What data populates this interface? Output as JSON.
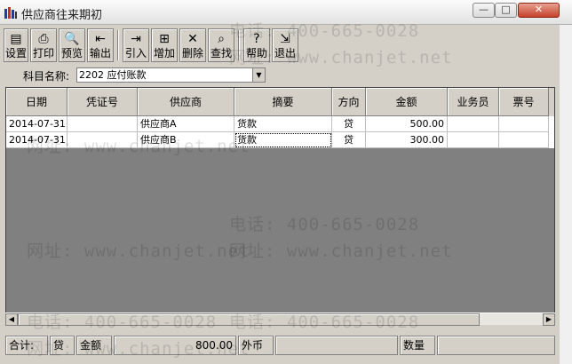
{
  "window": {
    "title": "供应商往来期初",
    "min_glyph": "—",
    "max_glyph": "□",
    "close_glyph": "✕"
  },
  "toolbar": {
    "buttons": [
      {
        "label": "设置",
        "icon": "settings-icon",
        "glyph": "▤"
      },
      {
        "label": "打印",
        "icon": "print-icon",
        "glyph": "⎙"
      },
      {
        "label": "预览",
        "icon": "preview-icon",
        "glyph": "🔍"
      },
      {
        "label": "输出",
        "icon": "export-icon",
        "glyph": "⇤"
      },
      {
        "label": "引入",
        "icon": "import-icon",
        "glyph": "⇥"
      },
      {
        "label": "增加",
        "icon": "add-icon",
        "glyph": "⊞"
      },
      {
        "label": "删除",
        "icon": "delete-icon",
        "glyph": "✕"
      },
      {
        "label": "查找",
        "icon": "find-icon",
        "glyph": "⌕"
      },
      {
        "label": "帮助",
        "icon": "help-icon",
        "glyph": "?"
      },
      {
        "label": "退出",
        "icon": "exit-icon",
        "glyph": "⇲"
      }
    ]
  },
  "subject": {
    "label": "科目名称:",
    "value": "2202 应付账款"
  },
  "table": {
    "columns": [
      "日期",
      "凭证号",
      "供应商",
      "摘要",
      "方向",
      "金额",
      "业务员",
      "票号"
    ],
    "rows": [
      {
        "date": "2014-07-31",
        "voucher": "",
        "supplier": "供应商A",
        "summary": "货款",
        "direction": "贷",
        "amount": "500.00",
        "salesman": "",
        "ticket": ""
      },
      {
        "date": "2014-07-31",
        "voucher": "",
        "supplier": "供应商B",
        "summary": "货款",
        "direction": "贷",
        "amount": "300.00",
        "salesman": "",
        "ticket": ""
      }
    ]
  },
  "status": {
    "total_label": "合计:",
    "direction": "贷",
    "amount_label": "金额",
    "amount_value": "800.00",
    "foreign_label": "外币",
    "qty_label": "数量"
  },
  "watermark": {
    "phone": "电话: 400-665-0028",
    "site": "网址: www.chanjet.net"
  },
  "colors": {
    "grid_background": "#808080",
    "chrome": "#d4d0c8",
    "close_button": "#c4402a"
  }
}
